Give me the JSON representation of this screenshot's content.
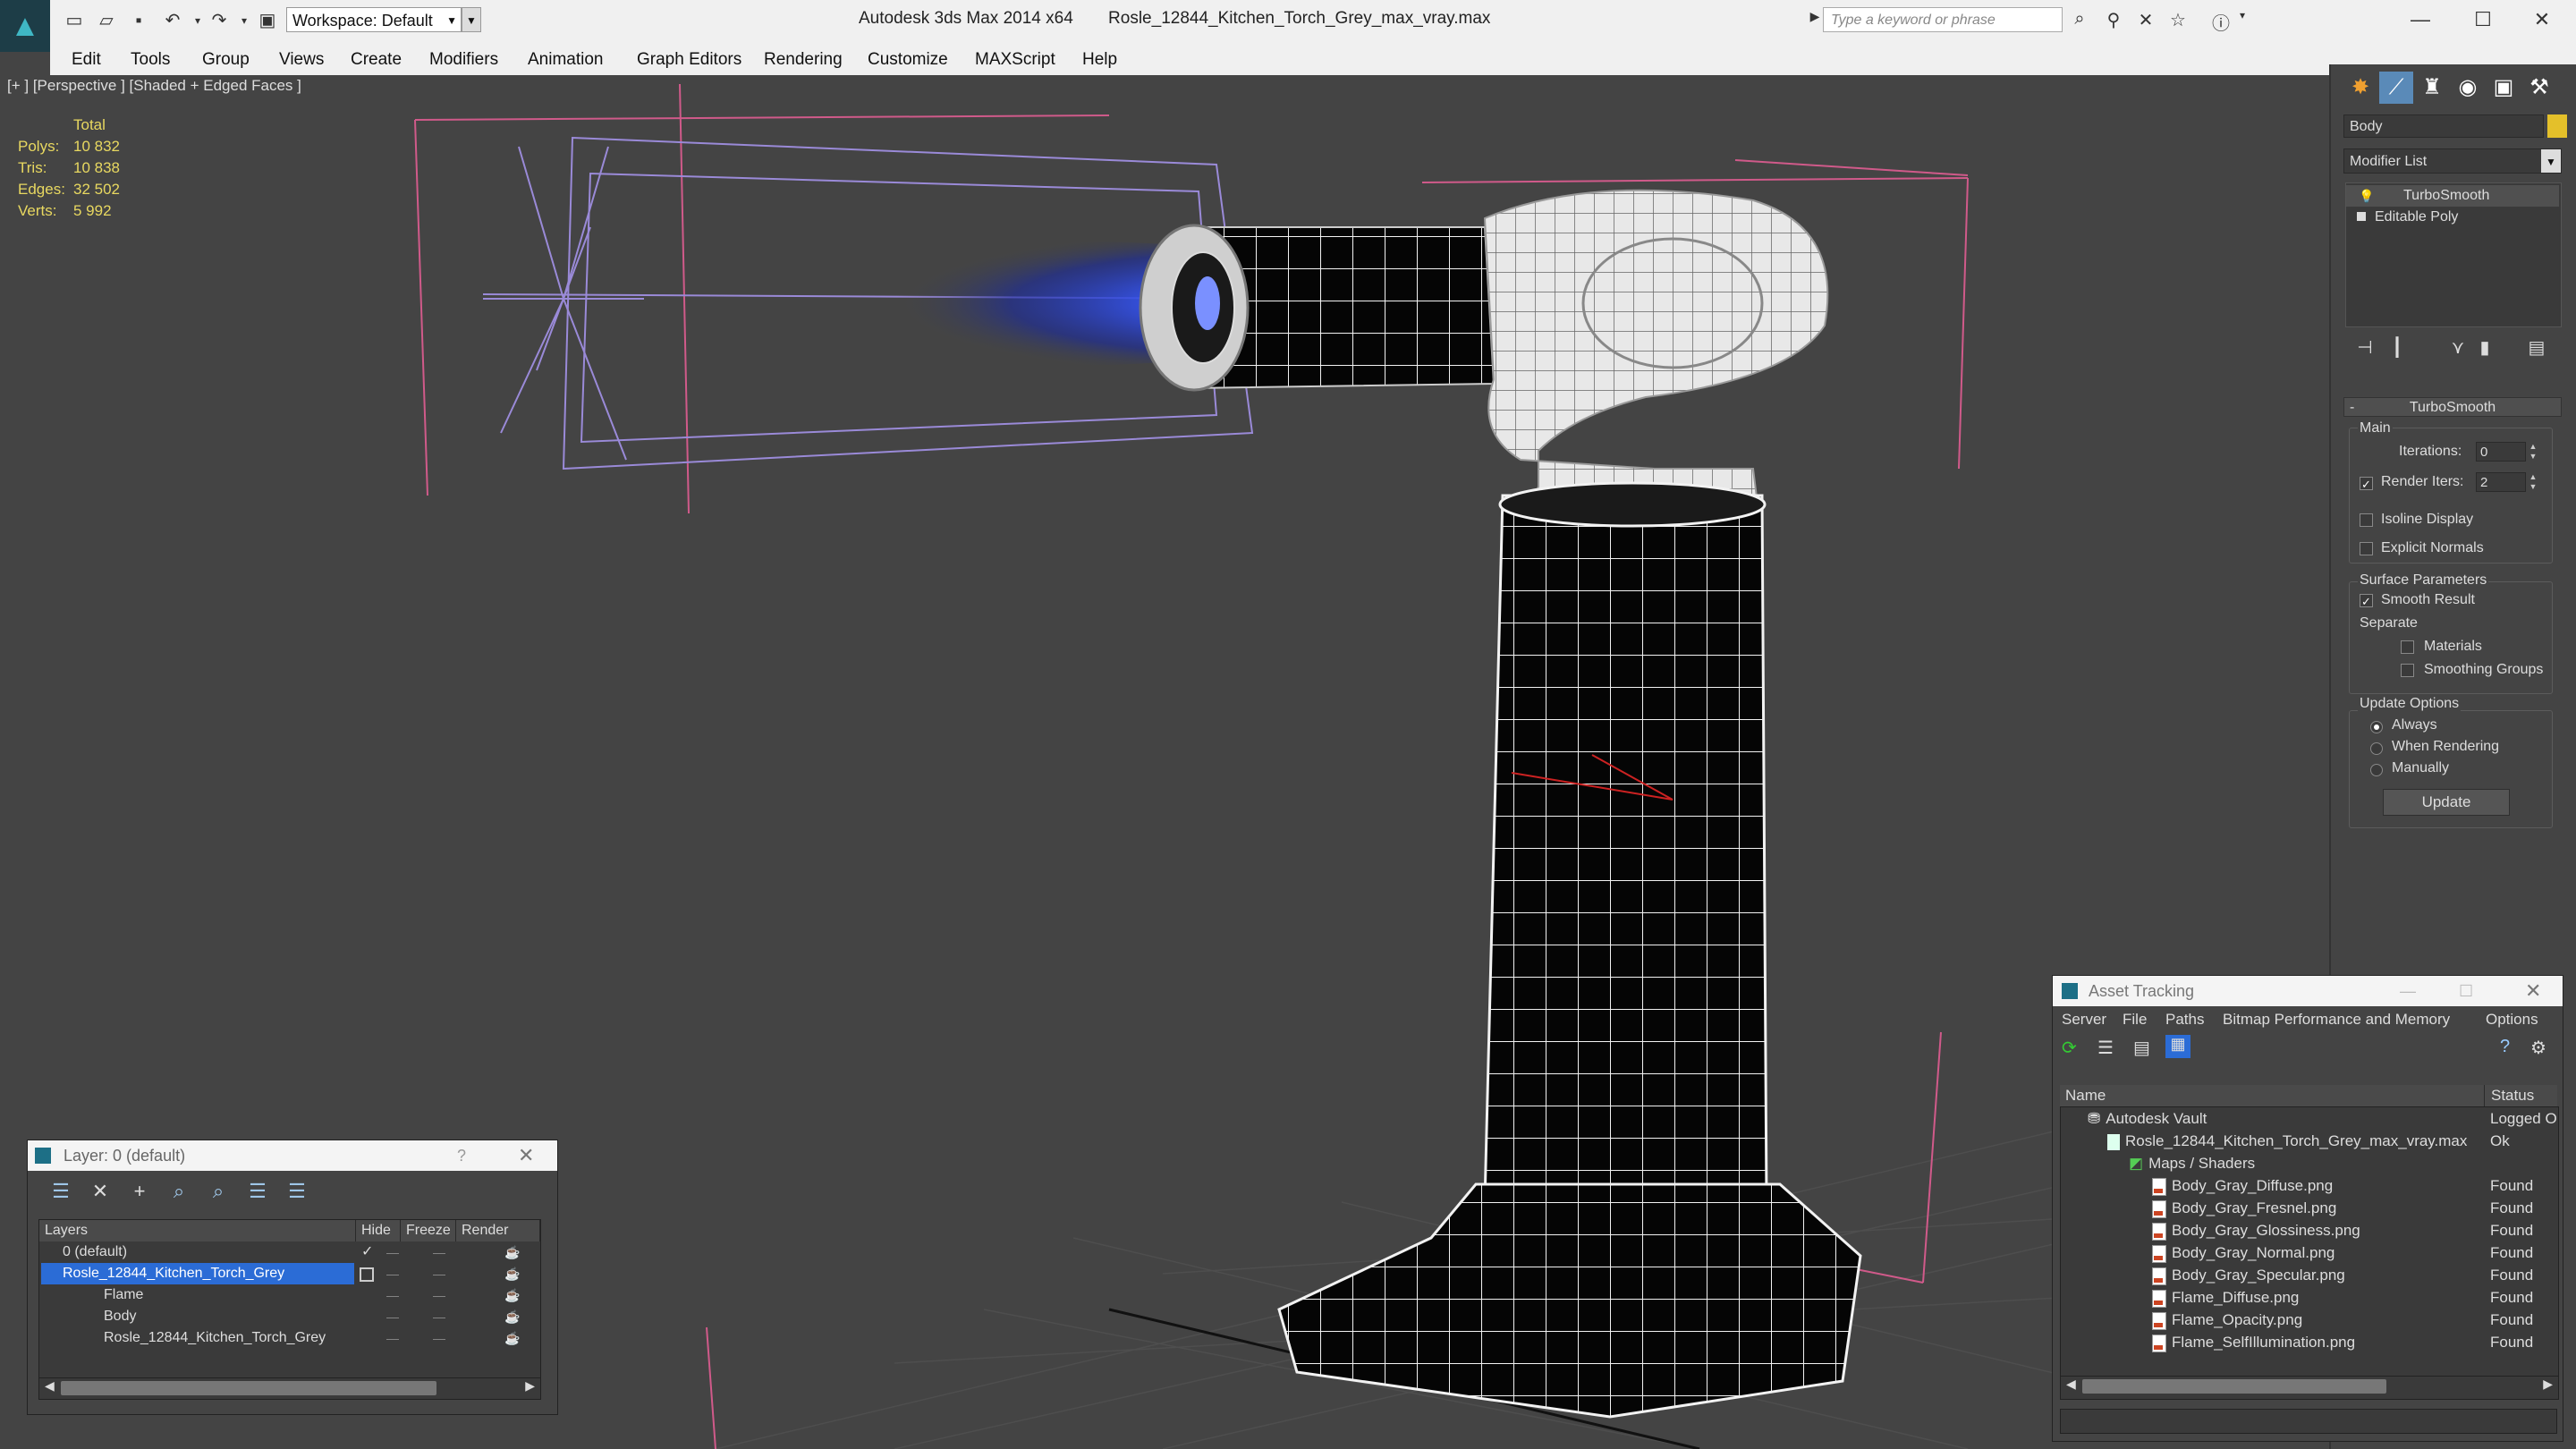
{
  "titlebar": {
    "app_title": "Autodesk 3ds Max  2014 x64",
    "file_name": "Rosle_12844_Kitchen_Torch_Grey_max_vray.max",
    "workspace": "Workspace: Default",
    "search_placeholder": "Type a keyword or phrase"
  },
  "menu": [
    "Edit",
    "Tools",
    "Group",
    "Views",
    "Create",
    "Modifiers",
    "Animation",
    "Graph Editors",
    "Rendering",
    "Customize",
    "MAXScript",
    "Help"
  ],
  "viewport": {
    "label": "[+ ] [Perspective ] [Shaded + Edged Faces ]",
    "stats": {
      "header": "Total",
      "rows": [
        {
          "key": "Polys:",
          "value": "10 832"
        },
        {
          "key": "Tris:",
          "value": "10 838"
        },
        {
          "key": "Edges:",
          "value": "32 502"
        },
        {
          "key": "Verts:",
          "value": "5 992"
        }
      ]
    }
  },
  "command_panel": {
    "object_name": "Body",
    "object_color": "#e4c02a",
    "modifier_list": "Modifier List",
    "stack": [
      "TurboSmooth",
      "Editable Poly"
    ],
    "turbosmooth": {
      "title": "TurboSmooth",
      "main_label": "Main",
      "iterations_label": "Iterations:",
      "iterations_value": "0",
      "render_iters_label": "Render Iters:",
      "render_iters_value": "2",
      "isoline_label": "Isoline Display",
      "explicit_normals_label": "Explicit Normals",
      "surface_params_label": "Surface Parameters",
      "smooth_result_label": "Smooth Result",
      "separate_label": "Separate",
      "materials_label": "Materials",
      "smoothing_groups_label": "Smoothing Groups",
      "update_options_label": "Update Options",
      "always_label": "Always",
      "when_rendering_label": "When Rendering",
      "manually_label": "Manually",
      "update_button": "Update"
    }
  },
  "layer_window": {
    "title": "Layer: 0 (default)",
    "help": "?",
    "columns": [
      "Layers",
      "Hide",
      "Freeze",
      "Render"
    ],
    "rows": [
      {
        "name": "0 (default)",
        "indent": 0
      },
      {
        "name": "Rosle_12844_Kitchen_Torch_Grey",
        "indent": 0
      },
      {
        "name": "Flame",
        "indent": 1
      },
      {
        "name": "Body",
        "indent": 1
      },
      {
        "name": "Rosle_12844_Kitchen_Torch_Grey",
        "indent": 1
      }
    ]
  },
  "asset_tracking": {
    "title": "Asset Tracking",
    "menu": [
      "Server",
      "File",
      "Paths",
      "Bitmap Performance and Memory",
      "Options"
    ],
    "columns": [
      "Name",
      "Status"
    ],
    "rows": [
      {
        "name": "Autodesk Vault",
        "status": "Logged O",
        "indent": 0
      },
      {
        "name": "Rosle_12844_Kitchen_Torch_Grey_max_vray.max",
        "status": "Ok",
        "indent": 1
      },
      {
        "name": "Maps / Shaders",
        "status": "",
        "indent": 2
      },
      {
        "name": "Body_Gray_Diffuse.png",
        "status": "Found",
        "indent": 3
      },
      {
        "name": "Body_Gray_Fresnel.png",
        "status": "Found",
        "indent": 3
      },
      {
        "name": "Body_Gray_Glossiness.png",
        "status": "Found",
        "indent": 3
      },
      {
        "name": "Body_Gray_Normal.png",
        "status": "Found",
        "indent": 3
      },
      {
        "name": "Body_Gray_Specular.png",
        "status": "Found",
        "indent": 3
      },
      {
        "name": "Flame_Diffuse.png",
        "status": "Found",
        "indent": 3
      },
      {
        "name": "Flame_Opacity.png",
        "status": "Found",
        "indent": 3
      },
      {
        "name": "Flame_SelfIllumination.png",
        "status": "Found",
        "indent": 3
      }
    ]
  }
}
